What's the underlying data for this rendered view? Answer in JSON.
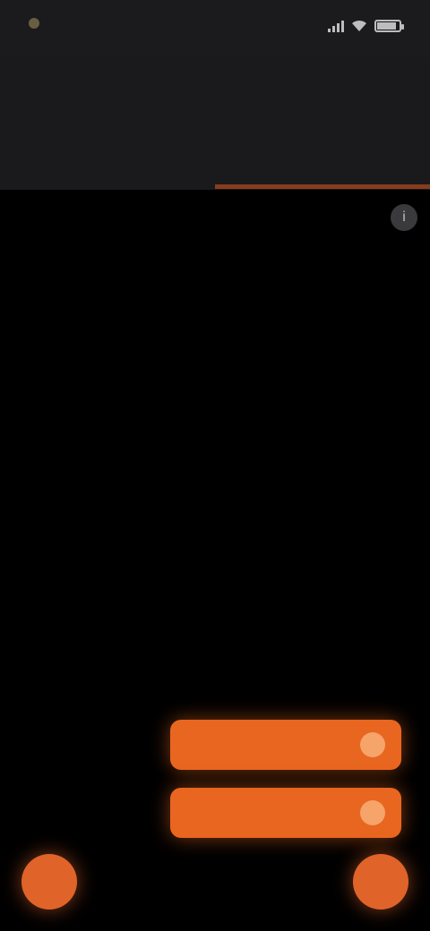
{
  "status_bar": {
    "time": "",
    "icons": [
      "signal-icon",
      "wifi-icon",
      "battery-icon"
    ],
    "battery_level": 0.8
  },
  "header": {
    "title": "",
    "tabs": [
      {
        "label": "",
        "active": false
      },
      {
        "label": "",
        "active": true
      }
    ]
  },
  "content": {
    "section_heading": "",
    "corner_action_icon": "info-icon"
  },
  "actions": {
    "primary_label": "",
    "secondary_label": "",
    "fab_left_icon": "mic-icon",
    "fab_right_icon": "camera-icon"
  },
  "colors": {
    "accent": "#e8661f",
    "background": "#000000",
    "header_background": "#1a1a1c"
  }
}
